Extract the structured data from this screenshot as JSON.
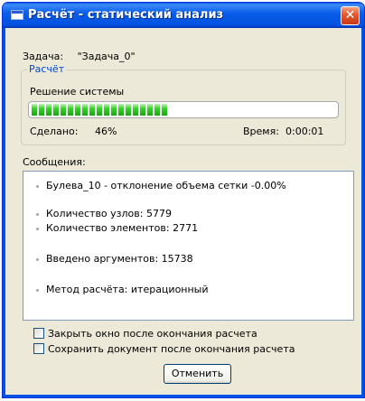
{
  "window": {
    "title": "Расчёт - статический анализ"
  },
  "task": {
    "label": "Задача:",
    "value": "\"Задача_0\""
  },
  "group": {
    "legend": "Расчёт",
    "solve_label": "Решение системы",
    "progress_fraction": 0.46,
    "done_label": "Сделано:",
    "done_value": "46%",
    "time_label": "Время:",
    "time_value": "0:00:01"
  },
  "messages": {
    "label": "Сообщения:",
    "items": [
      "Булева_10 - отклонение объема сетки -0.00%",
      "Количество узлов: 5779",
      "Количество элементов: 2771",
      "Введено аргументов: 15738",
      "Метод расчёта: итерационный"
    ]
  },
  "options": {
    "close_after": "Закрыть окно после окончания расчета",
    "save_after": "Сохранить документ после окончания расчета"
  },
  "buttons": {
    "cancel": "Отменить",
    "close_glyph": "✕"
  },
  "colors": {
    "title_bar": "#0054e3",
    "progress": "#36d12a",
    "legend": "#0046d5"
  }
}
